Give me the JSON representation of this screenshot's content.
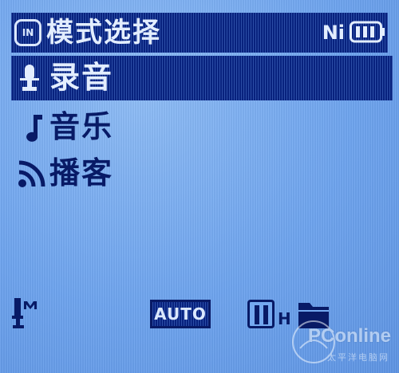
{
  "header": {
    "mode_icon_text": "IN",
    "title": "模式选择",
    "battery_type": "Ni"
  },
  "menu": {
    "items": [
      {
        "label": "录音",
        "icon": "microphone-icon",
        "selected": true
      },
      {
        "label": "音乐",
        "icon": "music-note-icon",
        "selected": false
      },
      {
        "label": "播客",
        "icon": "podcast-icon",
        "selected": false
      }
    ]
  },
  "status": {
    "auto_label": "AUTO",
    "quality_suffix": "H"
  },
  "watermark": {
    "brand": "PConline",
    "tagline": "太平洋电脑网"
  },
  "colors": {
    "screen_bg": "#74a9f0",
    "highlight_bg": "#08227e",
    "ink": "#081a66",
    "inverse_text": "#e3eeff"
  }
}
